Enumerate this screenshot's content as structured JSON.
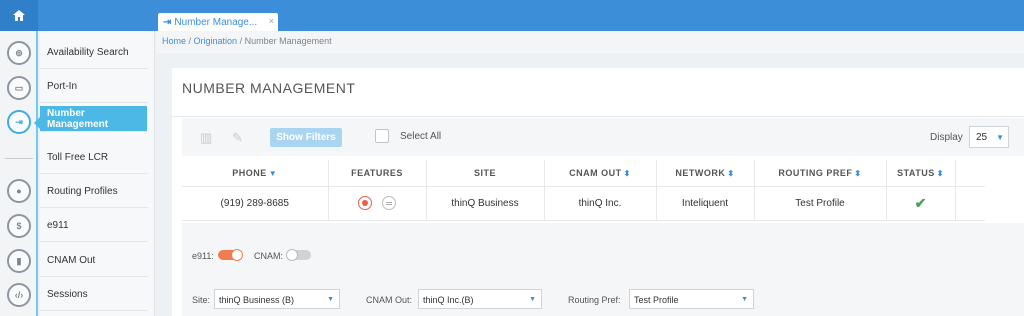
{
  "tab": {
    "label": "Number Manage...",
    "close": "×"
  },
  "breadcrumb": {
    "home": "Home",
    "sep1": " / ",
    "origination": "Origination",
    "sep2": " / ",
    "current": "Number Management"
  },
  "sidebar": {
    "items": [
      {
        "label": "Availability Search"
      },
      {
        "label": "Port-In"
      },
      {
        "label": "Number Management"
      },
      {
        "label": "Toll Free LCR"
      },
      {
        "label": "Routing Profiles"
      },
      {
        "label": "e911"
      },
      {
        "label": "CNAM Out"
      },
      {
        "label": "Sessions"
      }
    ]
  },
  "page": {
    "title": "NUMBER MANAGEMENT"
  },
  "toolbar": {
    "show_filters": "Show Filters",
    "select_all": "Select All",
    "display_label": "Display",
    "display_value": "25"
  },
  "table": {
    "headers": [
      "PHONE",
      "FEATURES",
      "SITE",
      "CNAM OUT",
      "NETWORK",
      "ROUTING PREF",
      "STATUS"
    ],
    "rows": [
      {
        "phone": "(919) 289-8685",
        "site": "thinQ Business",
        "cnam_out": "thinQ Inc.",
        "network": "Inteliquent",
        "routing_pref": "Test Profile",
        "status": "active"
      }
    ]
  },
  "details": {
    "e911_label": "e911:",
    "cnam_label": "CNAM:",
    "site_label": "Site:",
    "site_value": "thinQ Business (B)",
    "cnam_out_label": "CNAM Out:",
    "cnam_out_value": "thinQ Inc.(B)",
    "routing_label": "Routing Pref:",
    "routing_value": "Test Profile"
  },
  "colors": {
    "accent": "#3d8ed9",
    "active_nav": "#4bb8e6",
    "toggle_on": "#ef7d4f",
    "status_ok": "#4aa35a"
  }
}
